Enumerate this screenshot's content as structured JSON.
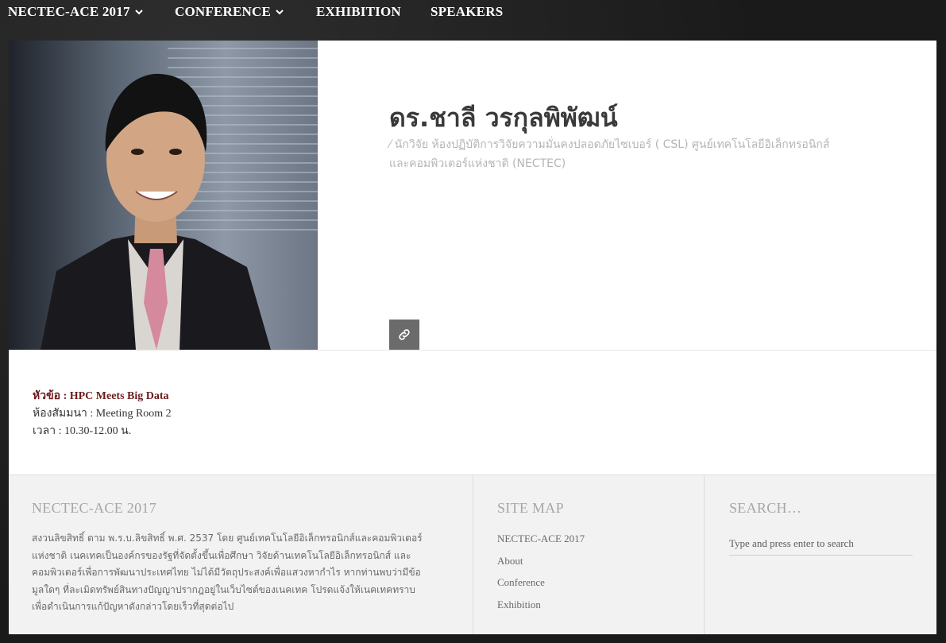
{
  "nav": {
    "items": [
      {
        "label": "NECTEC-ACE 2017",
        "has_dropdown": true
      },
      {
        "label": "CONFERENCE",
        "has_dropdown": true
      },
      {
        "label": "EXHIBITION",
        "has_dropdown": false
      },
      {
        "label": "SPEAKERS",
        "has_dropdown": false
      }
    ]
  },
  "speaker": {
    "name": "ดร.ชาลี วรกุลพิพัฒน์",
    "role_line1": "⁄  นักวิจัย ห้องปฏิบัติการวิจัยความมั่นคงปลอดภัยไซเบอร์ ( CSL)  ศูนย์เทคโนโลยีอิเล็กทรอนิกส์",
    "role_line2": "และคอมพิวเตอร์แห่งชาติ (NECTEC)",
    "link_icon": "link-icon"
  },
  "session": {
    "topic": "หัวข้อ : HPC Meets Big Data",
    "room": "ห้องสัมมนา : Meeting Room 2",
    "time": "เวลา : 10.30-12.00 น."
  },
  "footer": {
    "about": {
      "title": "NECTEC-ACE 2017",
      "lines": [
        "สงวนลิขสิทธิ์ ตาม พ.ร.บ.ลิขสิทธิ์ พ.ศ. 2537 โดย ศูนย์เทคโนโลยีอิเล็กทรอนิกส์และคอมพิวเตอร์",
        "แห่งชาติ เนคเทคเป็นองค์กรของรัฐที่จัดตั้งขึ้นเพื่อศึกษา วิจัยด้านเทคโนโลยีอิเล็กทรอนิกส์ และ",
        "คอมพิวเตอร์เพื่อการพัฒนาประเทศไทย ไม่ได้มีวัตถุประสงค์เพื่อแสวงหากำไร หากท่านพบว่ามีข้อ",
        "มูลใดๆ ที่ละเมิดทรัพย์สินทางปัญญาปรากฎอยู่ในเว็บไซต์ของเนคเทค โปรดแจ้งให้เนคเทคทราบ",
        "เพื่อดำเนินการแก้ปัญหาดังกล่าวโดยเร็วที่สุดต่อไป"
      ]
    },
    "sitemap": {
      "title": "SITE MAP",
      "items": [
        "NECTEC-ACE 2017",
        "About",
        "Conference",
        "Exhibition"
      ]
    },
    "search": {
      "title": "SEARCH…",
      "placeholder": "Type and press enter to search"
    }
  },
  "colors": {
    "topic": "#6b1c1c",
    "link_button": "#6b6b6b",
    "footer_bg": "#f2f2f2"
  }
}
